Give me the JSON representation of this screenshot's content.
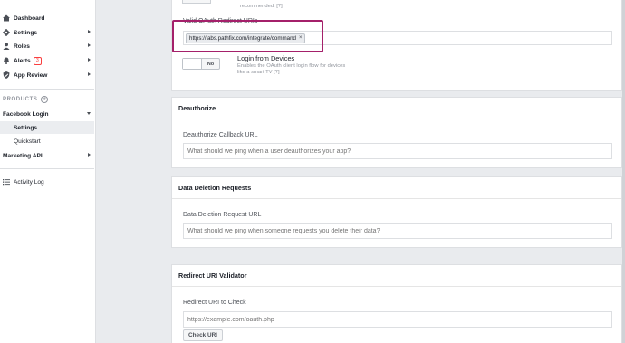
{
  "sidebar": {
    "items": [
      {
        "label": "Dashboard",
        "icon": "dashboard-icon"
      },
      {
        "label": "Settings",
        "icon": "gear-icon"
      },
      {
        "label": "Roles",
        "icon": "roles-icon"
      },
      {
        "label": "Alerts",
        "icon": "bell-icon",
        "badge": "3"
      },
      {
        "label": "App Review",
        "icon": "shield-icon"
      }
    ],
    "products_label": "PRODUCTS",
    "facebook_login": "Facebook Login",
    "fb_sub": [
      "Settings",
      "Quickstart"
    ],
    "marketing_api": "Marketing API",
    "activity_log": "Activity Log"
  },
  "login_panel": {
    "clipped_line1": "recommended.  [?]",
    "redirect_label": "Valid OAuth Redirect URIs",
    "redirect_tag": "https://labs.pathfix.com/integrate/command",
    "devices_title": "Login from Devices",
    "devices_desc": "Enables the OAuth client login flow for devices like a smart TV [?]",
    "toggle_state": "No"
  },
  "deauthorize": {
    "title": "Deauthorize",
    "field_label": "Deauthorize Callback URL",
    "placeholder": "What should we ping when a user deauthorizes your app?"
  },
  "data_deletion": {
    "title": "Data Deletion Requests",
    "field_label": "Data Deletion Request URL",
    "placeholder": "What should we ping when someone requests you delete their data?"
  },
  "validator": {
    "title": "Redirect URI Validator",
    "field_label": "Redirect URI to Check",
    "placeholder": "https://example.com/oauth.php",
    "button": "Check URI"
  },
  "colors": {
    "highlight": "#a4206a",
    "alert": "#fa3e3e"
  }
}
